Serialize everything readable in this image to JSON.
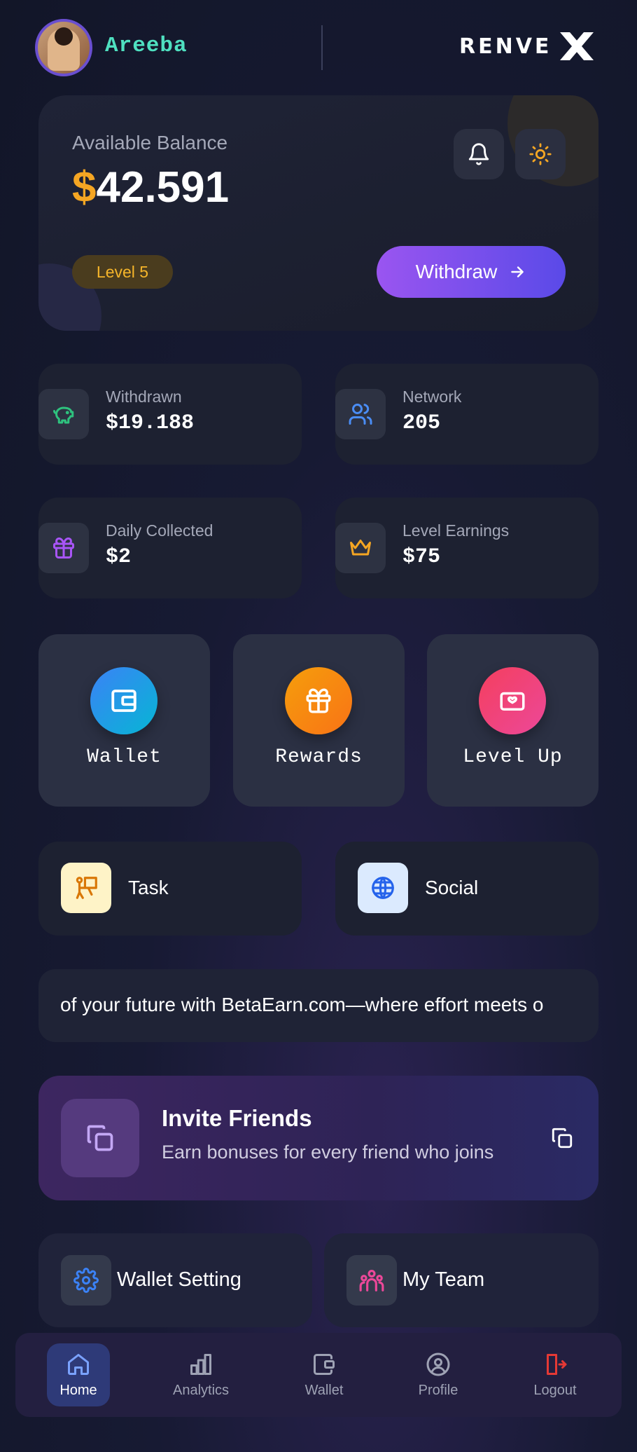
{
  "header": {
    "username": "Areeba",
    "logo_text": "RENVE"
  },
  "balance": {
    "label": "Available Balance",
    "currency": "$",
    "amount": "42.591",
    "level": "Level 5",
    "withdraw_label": "Withdraw"
  },
  "stats": [
    {
      "label": "Withdrawn",
      "value": "$19.188"
    },
    {
      "label": "Network",
      "value": "205"
    },
    {
      "label": "Daily Collected",
      "value": "$2"
    },
    {
      "label": "Level Earnings",
      "value": "$75"
    }
  ],
  "quick_actions": [
    {
      "label": "Wallet"
    },
    {
      "label": "Rewards"
    },
    {
      "label": "Level Up"
    }
  ],
  "links": {
    "task": "Task",
    "social": "Social"
  },
  "ticker": {
    "text": "of your future with BetaEarn.com—where effort meets o"
  },
  "invite": {
    "title": "Invite Friends",
    "subtitle": "Earn bonuses for every friend who joins"
  },
  "settings": {
    "wallet_setting": "Wallet Setting",
    "my_team": "My Team"
  },
  "nav": [
    {
      "label": "Home"
    },
    {
      "label": "Analytics"
    },
    {
      "label": "Wallet"
    },
    {
      "label": "Profile"
    },
    {
      "label": "Logout"
    }
  ],
  "colors": {
    "accent_gold": "#f5a623",
    "username_teal": "#4fe0c0",
    "withdraw_gradient_start": "#9a55f0",
    "withdraw_gradient_end": "#5a4ae8",
    "logout_red": "#e53935"
  }
}
